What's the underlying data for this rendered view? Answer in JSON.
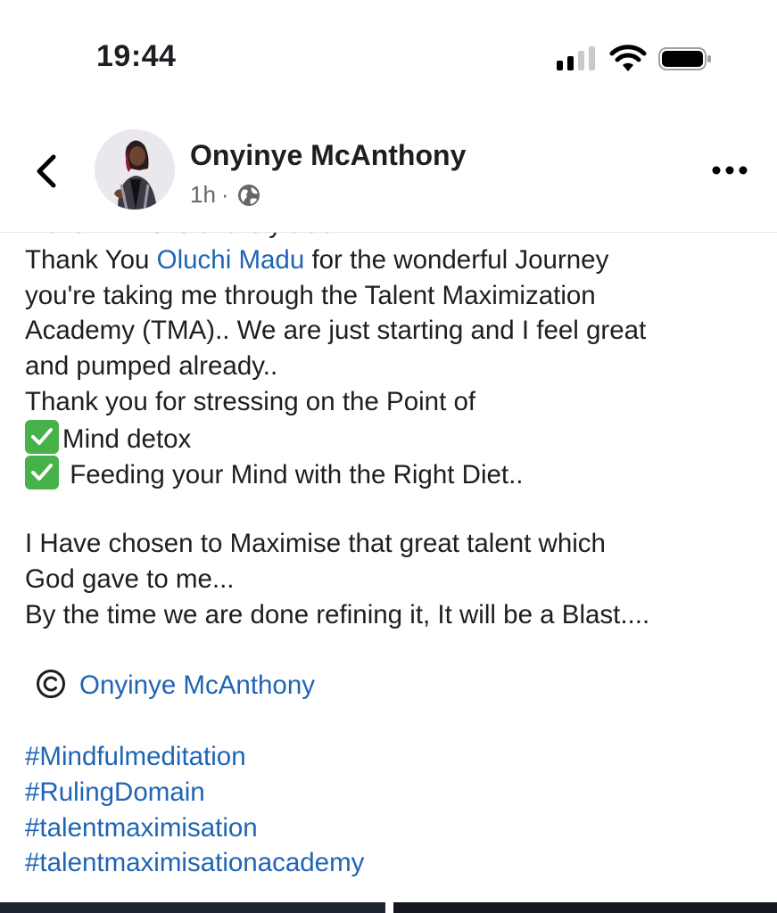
{
  "status_bar": {
    "time": "19:44"
  },
  "post": {
    "author": "Onyinye McAnthony",
    "time_ago": "1h",
    "separator": "·",
    "partial_line": "He is... This is entirely true..",
    "lines": {
      "l1_a": "Thank You ",
      "l1_mention": "Oluchi Madu",
      "l1_b": " for the wonderful Journey",
      "l2": "you're taking me through the Talent Maximization",
      "l3": "Academy (TMA).. We are just starting and I feel great",
      "l4": "and pumped already..",
      "l5": "Thank you for stressing on the Point of",
      "check1": "Mind detox",
      "check2": " Feeding your Mind with the Right Diet..",
      "l8": "I Have chosen to Maximise that great talent which",
      "l9": "God gave to me...",
      "l10": "By the time we are done refining it, It will be a Blast...."
    },
    "credit_mention": "Onyinye McAnthony",
    "hashtags": [
      "#Mindfulmeditation",
      "#RulingDomain",
      "#talentmaximisation",
      "#talentmaximisationacademy"
    ]
  },
  "colors": {
    "link": "#1f64b5",
    "text": "#1c1e21",
    "meta": "#65676b",
    "check_green": "#47b14a"
  },
  "icons": [
    "back-chevron-icon",
    "globe-icon",
    "more-dots-icon",
    "check-mark-icon",
    "copyright-icon",
    "signal-icon",
    "wifi-icon",
    "battery-icon"
  ]
}
